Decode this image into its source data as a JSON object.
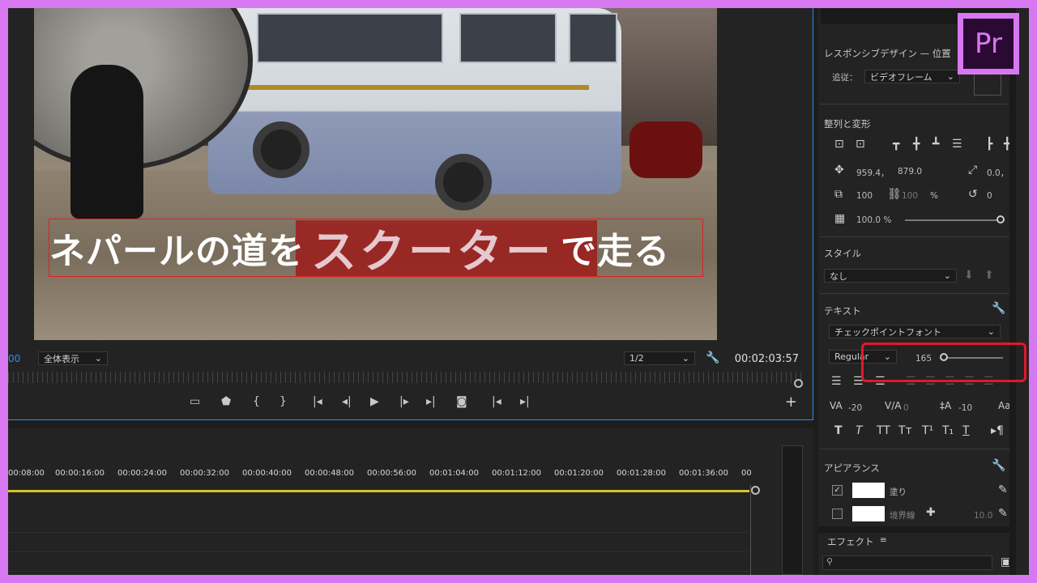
{
  "monitor": {
    "title_overlay": {
      "before": "ネパールの道を",
      "highlight": "スクーター",
      "after": "で走る"
    },
    "timecode_left": "00",
    "zoom_select": "全体表示",
    "quality_select": "1/2",
    "timecode_right": "00:02:03:57"
  },
  "timeline": {
    "ticks": [
      "00:08:00",
      "00:00:16:00",
      "00:00:24:00",
      "00:00:32:00",
      "00:00:40:00",
      "00:00:48:00",
      "00:00:56:00",
      "00:01:04:00",
      "00:01:12:00",
      "00:01:20:00",
      "00:01:28:00",
      "00:01:36:00",
      "00"
    ]
  },
  "essential_graphics": {
    "responsive_header": "レスポンシブデザイン — 位置",
    "follow_label": "追従：",
    "follow_value": "ビデオフレーム",
    "align_header": "整列と変形",
    "position_x": "959.4，",
    "position_y": "879.0",
    "anchor": "0.0，",
    "scale": "100",
    "scale_locked": "100",
    "scale_unit": "%",
    "rotation": "0",
    "opacity": "100.0 %",
    "style_header": "スタイル",
    "style_value": "なし",
    "text_header": "テキスト",
    "font_value": "チェックポイントフォント",
    "font_style": "Regular",
    "font_size": "165",
    "tracking": "-20",
    "kerning": "0",
    "leading": "-10",
    "appearance_header": "アピアランス",
    "fill_label": "塗り",
    "stroke_label": "境界線",
    "stroke_width": "10.0",
    "effects_header": "エフェクト",
    "effects_menu": "≡"
  },
  "logo": {
    "text": "Pr"
  },
  "colors": {
    "accent": "#2d8ceb",
    "frame": "#d878f0",
    "highlight_box": "#e0182d",
    "playhead": "#d9c22b"
  }
}
